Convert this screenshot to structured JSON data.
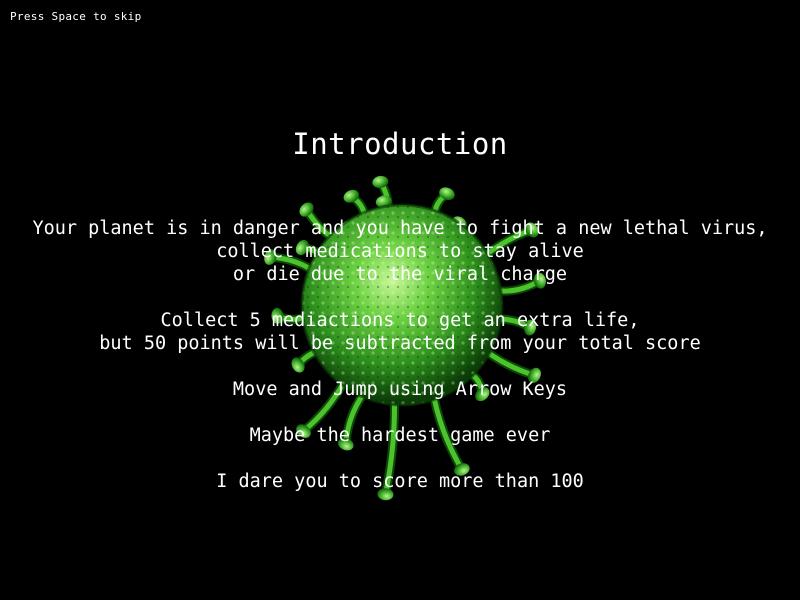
{
  "skip_hint": "Press Space to skip",
  "title": "Introduction",
  "paragraphs": [
    {
      "lines": [
        "Your planet is in danger and you have to fight a new lethal virus,",
        "collect medications to stay alive",
        "or die due to the viral charge"
      ]
    },
    {
      "lines": [
        "Collect 5 mediactions to get an extra life,",
        "but 50 points will be subtracted from your total score"
      ]
    },
    {
      "lines": [
        "Move and Jump using Arrow Keys"
      ]
    },
    {
      "lines": [
        "Maybe the hardest game ever"
      ]
    },
    {
      "lines": [
        "I dare you to score more than 100"
      ]
    }
  ],
  "colors": {
    "background": "#000000",
    "text": "#ffffff",
    "virus_body": "#3fa82a",
    "virus_dark": "#0d4a08",
    "virus_highlight": "#b6ef8a"
  },
  "background_image": "green-virus-icon"
}
